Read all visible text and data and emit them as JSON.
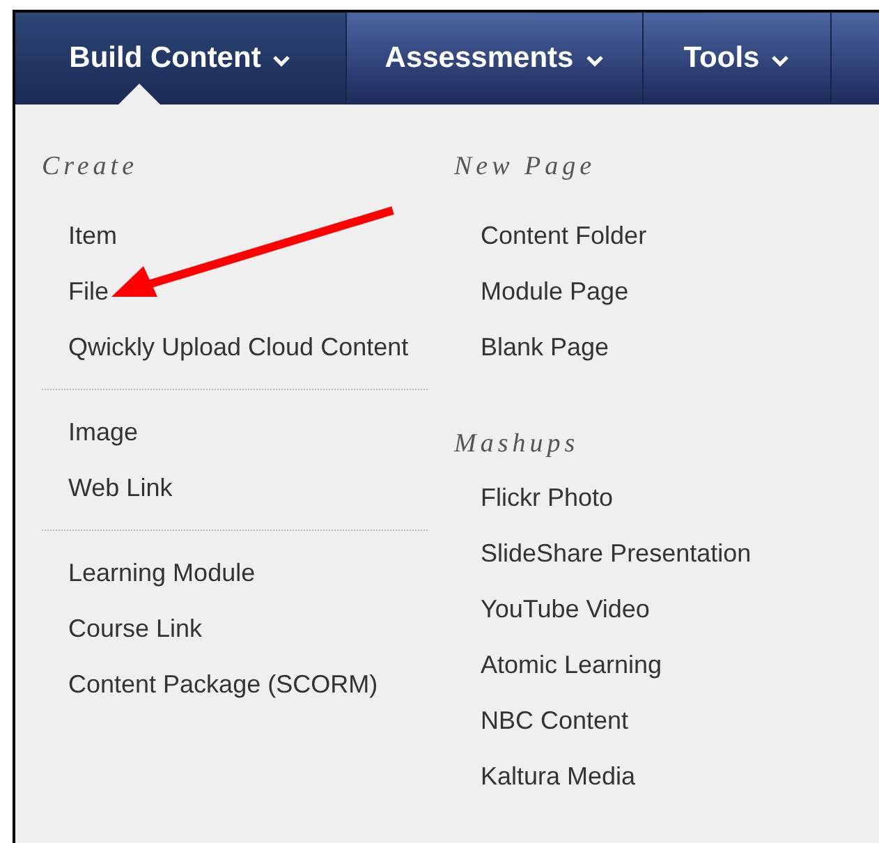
{
  "tabs": [
    {
      "label": "Build Content",
      "selected": true
    },
    {
      "label": "Assessments",
      "selected": false
    },
    {
      "label": "Tools",
      "selected": false
    }
  ],
  "create": {
    "heading": "Create",
    "groups": [
      [
        "Item",
        "File",
        "Qwickly Upload Cloud Content"
      ],
      [
        "Image",
        "Web Link"
      ],
      [
        "Learning Module",
        "Course Link",
        "Content Package (SCORM)"
      ]
    ]
  },
  "right_sections": [
    {
      "heading": "New Page",
      "items": [
        "Content Folder",
        "Module Page",
        "Blank Page"
      ]
    },
    {
      "heading": "Mashups",
      "items": [
        "Flickr Photo",
        "SlideShare Presentation",
        "YouTube Video",
        "Atomic Learning",
        "NBC Content",
        "Kaltura Media"
      ]
    }
  ]
}
